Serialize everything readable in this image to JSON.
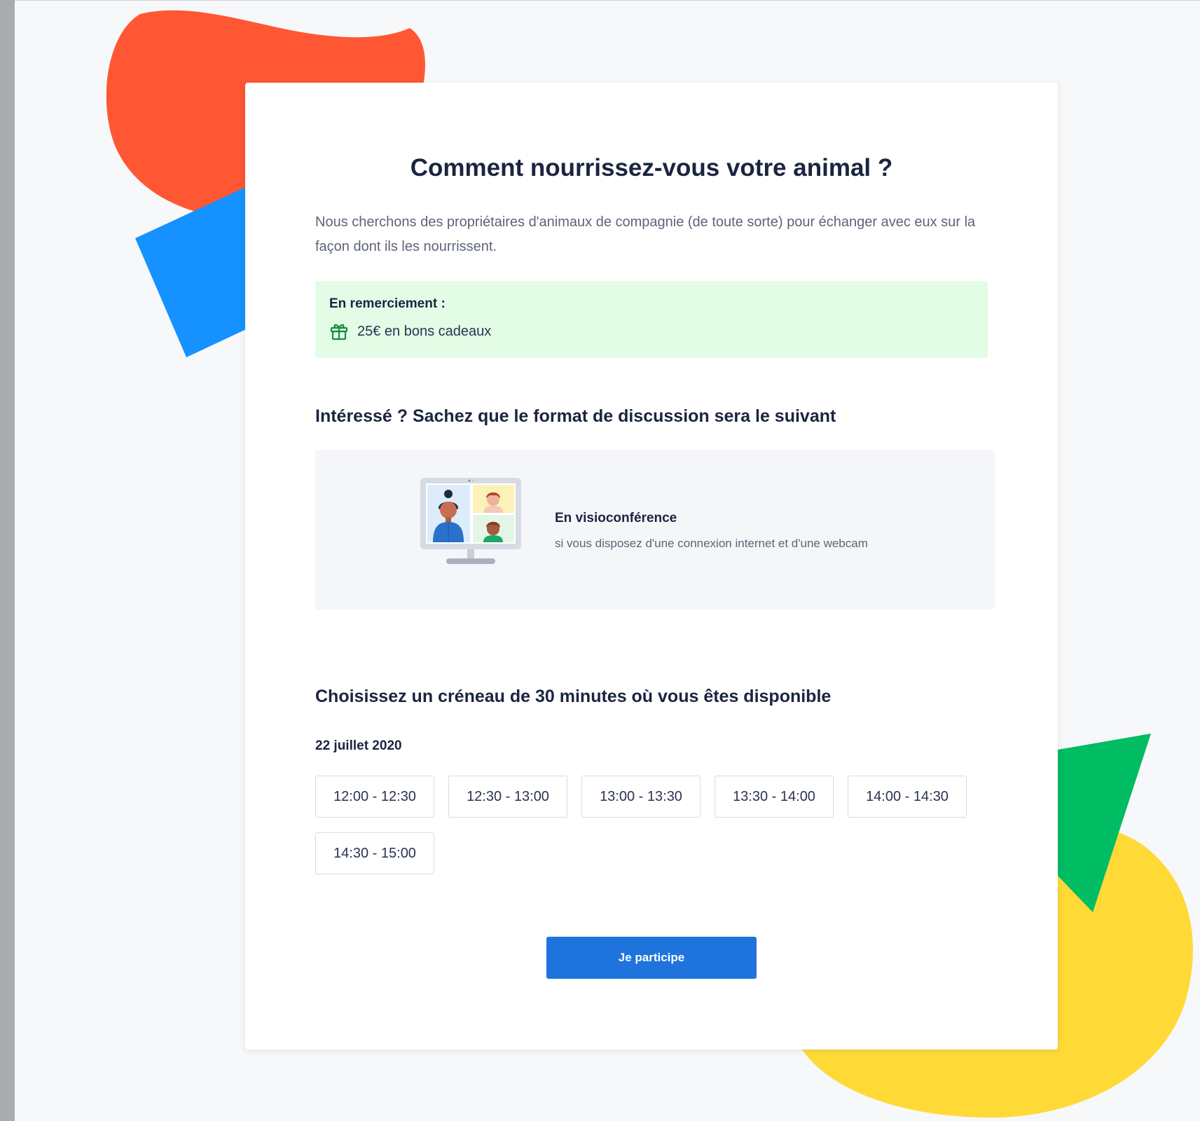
{
  "colors": {
    "page_background": "#f7f8fa",
    "blob_red": "#ff5733",
    "square_blue": "#1592ff",
    "blob_yellow": "#ffda37",
    "triangle_green": "#00bc63",
    "reward_background": "#e3fce6",
    "gift_icon": "#1a8a42",
    "primary_button": "#1e74dc",
    "heading_text": "#1b2540",
    "body_text": "#5d6479"
  },
  "survey": {
    "title": "Comment nourrissez-vous votre animal ?",
    "intro": "Nous cherchons des propriétaires d'animaux de compagnie (de toute sorte) pour échanger avec eux sur la façon dont ils les nourrissent."
  },
  "reward": {
    "heading": "En remerciement :",
    "icon": "gift-icon",
    "text": "25€ en bons cadeaux"
  },
  "format": {
    "heading": "Intéressé ? Sachez que le format de discussion sera le suivant",
    "illustration": "video-call-illustration",
    "title": "En visioconférence",
    "description": "si vous disposez d'une connexion internet et d'une webcam"
  },
  "schedule": {
    "heading": "Choisissez un créneau de 30 minutes où vous êtes disponible",
    "date": "22 juillet 2020",
    "slots": [
      "12:00 - 12:30",
      "12:30 - 13:00",
      "13:00 - 13:30",
      "13:30 - 14:00",
      "14:00 - 14:30",
      "14:30 - 15:00"
    ]
  },
  "cta": {
    "label": "Je participe"
  }
}
